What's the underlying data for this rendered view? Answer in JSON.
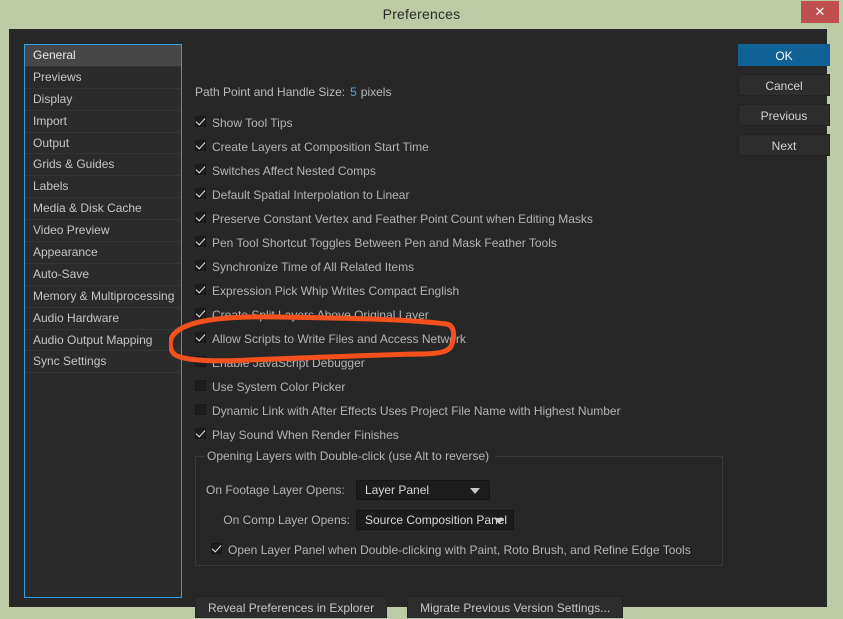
{
  "window": {
    "title": "Preferences",
    "close_label": "✕"
  },
  "sidebar": {
    "items": [
      {
        "label": "General",
        "selected": true
      },
      {
        "label": "Previews",
        "selected": false
      },
      {
        "label": "Display",
        "selected": false
      },
      {
        "label": "Import",
        "selected": false
      },
      {
        "label": "Output",
        "selected": false
      },
      {
        "label": "Grids & Guides",
        "selected": false
      },
      {
        "label": "Labels",
        "selected": false
      },
      {
        "label": "Media & Disk Cache",
        "selected": false
      },
      {
        "label": "Video Preview",
        "selected": false
      },
      {
        "label": "Appearance",
        "selected": false
      },
      {
        "label": "Auto-Save",
        "selected": false
      },
      {
        "label": "Memory & Multiprocessing",
        "selected": false
      },
      {
        "label": "Audio Hardware",
        "selected": false
      },
      {
        "label": "Audio Output Mapping",
        "selected": false
      },
      {
        "label": "Sync Settings",
        "selected": false
      }
    ]
  },
  "main": {
    "path_size": {
      "label": "Path Point and Handle Size:",
      "value": "5",
      "unit": "pixels"
    },
    "checkboxes": [
      {
        "label": "Show Tool Tips",
        "checked": true
      },
      {
        "label": "Create Layers at Composition Start Time",
        "checked": true
      },
      {
        "label": "Switches Affect Nested Comps",
        "checked": true
      },
      {
        "label": "Default Spatial Interpolation to Linear",
        "checked": true
      },
      {
        "label": "Preserve Constant Vertex and Feather Point Count when Editing Masks",
        "checked": true
      },
      {
        "label": "Pen Tool Shortcut Toggles Between Pen and Mask Feather Tools",
        "checked": true
      },
      {
        "label": "Synchronize Time of All Related Items",
        "checked": true
      },
      {
        "label": "Expression Pick Whip Writes Compact English",
        "checked": true
      },
      {
        "label": "Create Split Layers Above Original Layer",
        "checked": true
      },
      {
        "label": "Allow Scripts to Write Files and Access Network",
        "checked": true
      },
      {
        "label": "Enable JavaScript Debugger",
        "checked": false
      },
      {
        "label": "Use System Color Picker",
        "checked": false
      },
      {
        "label": "Dynamic Link with After Effects Uses Project File Name with Highest Number",
        "checked": false
      },
      {
        "label": "Play Sound When Render Finishes",
        "checked": true
      }
    ],
    "group": {
      "legend": "Opening Layers with Double-click (use Alt to reverse)",
      "footage_label": "On Footage Layer Opens:",
      "footage_value": "Layer Panel",
      "comp_label": "On Comp Layer Opens:",
      "comp_value": "Source Composition Panel",
      "open_layer_checkbox": {
        "label": "Open Layer Panel when Double-clicking with Paint, Roto Brush, and Refine Edge Tools",
        "checked": true
      }
    },
    "bottom_buttons": [
      {
        "label": "Reveal Preferences in Explorer"
      },
      {
        "label": "Migrate Previous Version Settings..."
      }
    ]
  },
  "actions": {
    "buttons": [
      {
        "label": "OK",
        "primary": true
      },
      {
        "label": "Cancel",
        "primary": false
      },
      {
        "label": "Previous",
        "primary": false
      },
      {
        "label": "Next",
        "primary": false
      }
    ]
  },
  "annotation": {
    "color": "#f4511e",
    "target": "Allow Scripts to Write Files and Access Network"
  }
}
